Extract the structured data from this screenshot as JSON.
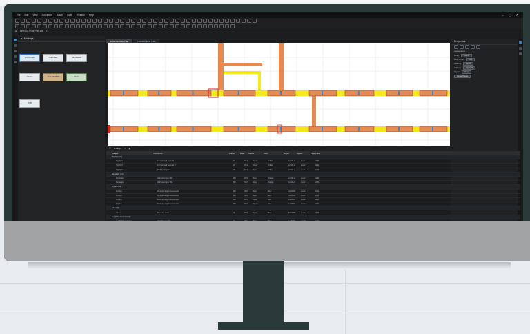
{
  "app": {
    "menu": [
      "File",
      "Edit",
      "View",
      "Document",
      "Batch",
      "Tools",
      "Window",
      "Help"
    ],
    "file_tab": "Level-02-Floor Plan.pdf"
  },
  "left_panel": {
    "title": "Markups",
    "stamps": [
      {
        "id": "s1",
        "label": "APPROVED",
        "style": "blue"
      },
      {
        "id": "s2",
        "label": "CHECKED",
        "style": "plain"
      },
      {
        "id": "s3",
        "label": "REVIEWED",
        "style": "plain"
      },
      {
        "id": "s4",
        "label": "DRAFT",
        "style": "plain"
      },
      {
        "id": "s5",
        "label": "FOR REVIEW",
        "style": "tan"
      },
      {
        "id": "s6",
        "label": "FINAL",
        "style": "green"
      },
      {
        "id": "s7",
        "label": "VOID",
        "style": "plain"
      }
    ]
  },
  "drawing_tabs": [
    "Level-02-Floor Plan",
    "Level-03-Floor Plan"
  ],
  "right_panel": {
    "title": "Properties",
    "rows": [
      {
        "label": "Appearance",
        "value": ""
      },
      {
        "label": "Color",
        "value": "Yellow"
      },
      {
        "label": "Line Width",
        "value": "1.00"
      },
      {
        "label": "Opacity",
        "value": "100%"
      },
      {
        "label": "Subject",
        "value": "Highlight"
      },
      {
        "label": "Layer",
        "value": "None"
      }
    ],
    "button_label": "Set as Default"
  },
  "markups_list": {
    "title": "Markups",
    "columns": [
      "Subject",
      "Comments",
      "Author",
      "Date",
      "Status",
      "Color",
      "Layer",
      "Space",
      "Page Label"
    ],
    "rows": [
      {
        "type": "group",
        "subject": "Highlight (18)",
        "comments": "",
        "author": "",
        "date": "",
        "status": "",
        "color": "",
        "layer": "",
        "space": "",
        "page": ""
      },
      {
        "type": "child",
        "subject": "Highlight",
        "comments": "Corridor wall segment A",
        "author": "JD",
        "date": "3/14",
        "status": "Open",
        "color": "Yellow",
        "layer": "A-WALL",
        "space": "Level 2",
        "page": "A2.01"
      },
      {
        "type": "child",
        "subject": "Highlight",
        "comments": "Corridor wall segment B",
        "author": "JD",
        "date": "3/14",
        "status": "Open",
        "color": "Yellow",
        "layer": "A-WALL",
        "space": "Level 2",
        "page": "A2.01"
      },
      {
        "type": "child",
        "subject": "Highlight",
        "comments": "Partition at grid 4",
        "author": "JD",
        "date": "3/14",
        "status": "Open",
        "color": "Yellow",
        "layer": "A-WALL",
        "space": "Level 2",
        "page": "A2.01"
      },
      {
        "type": "group",
        "subject": "Rectangle (24)",
        "comments": "",
        "author": "",
        "date": "",
        "status": "",
        "color": "",
        "layer": "",
        "space": "",
        "page": ""
      },
      {
        "type": "child",
        "subject": "Rectangle",
        "comments": "Wall panel type W1",
        "author": "MK",
        "date": "3/15",
        "status": "Done",
        "color": "Orange",
        "layer": "A-WALL",
        "space": "Level 2",
        "page": "A2.01"
      },
      {
        "type": "child",
        "subject": "Rectangle",
        "comments": "Wall panel type W1",
        "author": "MK",
        "date": "3/15",
        "status": "Done",
        "color": "Orange",
        "layer": "A-WALL",
        "space": "Level 2",
        "page": "A2.01"
      },
      {
        "type": "group",
        "subject": "Polyline (12)",
        "comments": "",
        "author": "",
        "date": "",
        "status": "",
        "color": "",
        "layer": "",
        "space": "",
        "page": ""
      },
      {
        "type": "child",
        "subject": "Polyline",
        "comments": "Door opening measurement",
        "author": "MK",
        "date": "3/15",
        "status": "Open",
        "color": "Red",
        "layer": "A-DOOR",
        "space": "Level 2",
        "page": "A2.01"
      },
      {
        "type": "child",
        "subject": "Polyline",
        "comments": "Door opening measurement",
        "author": "MK",
        "date": "3/15",
        "status": "Open",
        "color": "Red",
        "layer": "A-DOOR",
        "space": "Level 2",
        "page": "A2.01"
      },
      {
        "type": "child",
        "subject": "Polyline",
        "comments": "Door opening measurement",
        "author": "MK",
        "date": "3/15",
        "status": "Open",
        "color": "Red",
        "layer": "A-DOOR",
        "space": "Level 2",
        "page": "A2.01"
      },
      {
        "type": "child",
        "subject": "Polyline",
        "comments": "Door opening measurement",
        "author": "MK",
        "date": "3/15",
        "status": "Open",
        "color": "Red",
        "layer": "A-DOOR",
        "space": "Level 2",
        "page": "A2.01"
      },
      {
        "type": "group",
        "subject": "Count (6)",
        "comments": "",
        "author": "",
        "date": "",
        "status": "",
        "color": "",
        "layer": "",
        "space": "",
        "page": ""
      },
      {
        "type": "child",
        "subject": "Count",
        "comments": "Electrical outlet",
        "author": "AL",
        "date": "3/16",
        "status": "Open",
        "color": "Blue",
        "layer": "E-POWR",
        "space": "Level 2",
        "page": "A2.01"
      },
      {
        "type": "group",
        "subject": "Length Measurement (9)",
        "comments": "",
        "author": "",
        "date": "",
        "status": "",
        "color": "",
        "layer": "",
        "space": "",
        "page": ""
      },
      {
        "type": "child",
        "subject": "Length Measurement",
        "comments": "Corridor run total",
        "author": "AL",
        "date": "3/16",
        "status": "Open",
        "color": "Red",
        "layer": "A-ANNO",
        "space": "Level 2",
        "page": "A2.01"
      },
      {
        "type": "child",
        "subject": "Length Measurement",
        "comments": "Corridor run total",
        "author": "AL",
        "date": "3/16",
        "status": "Open",
        "color": "Red",
        "layer": "A-ANNO",
        "space": "Level 2",
        "page": "A2.01"
      }
    ]
  },
  "colors": {
    "highlight": "#f5e81c",
    "panel": "#e58a53",
    "door": "#d4261d",
    "accent": "#3c86c9",
    "bezel": "#2a3a38"
  }
}
